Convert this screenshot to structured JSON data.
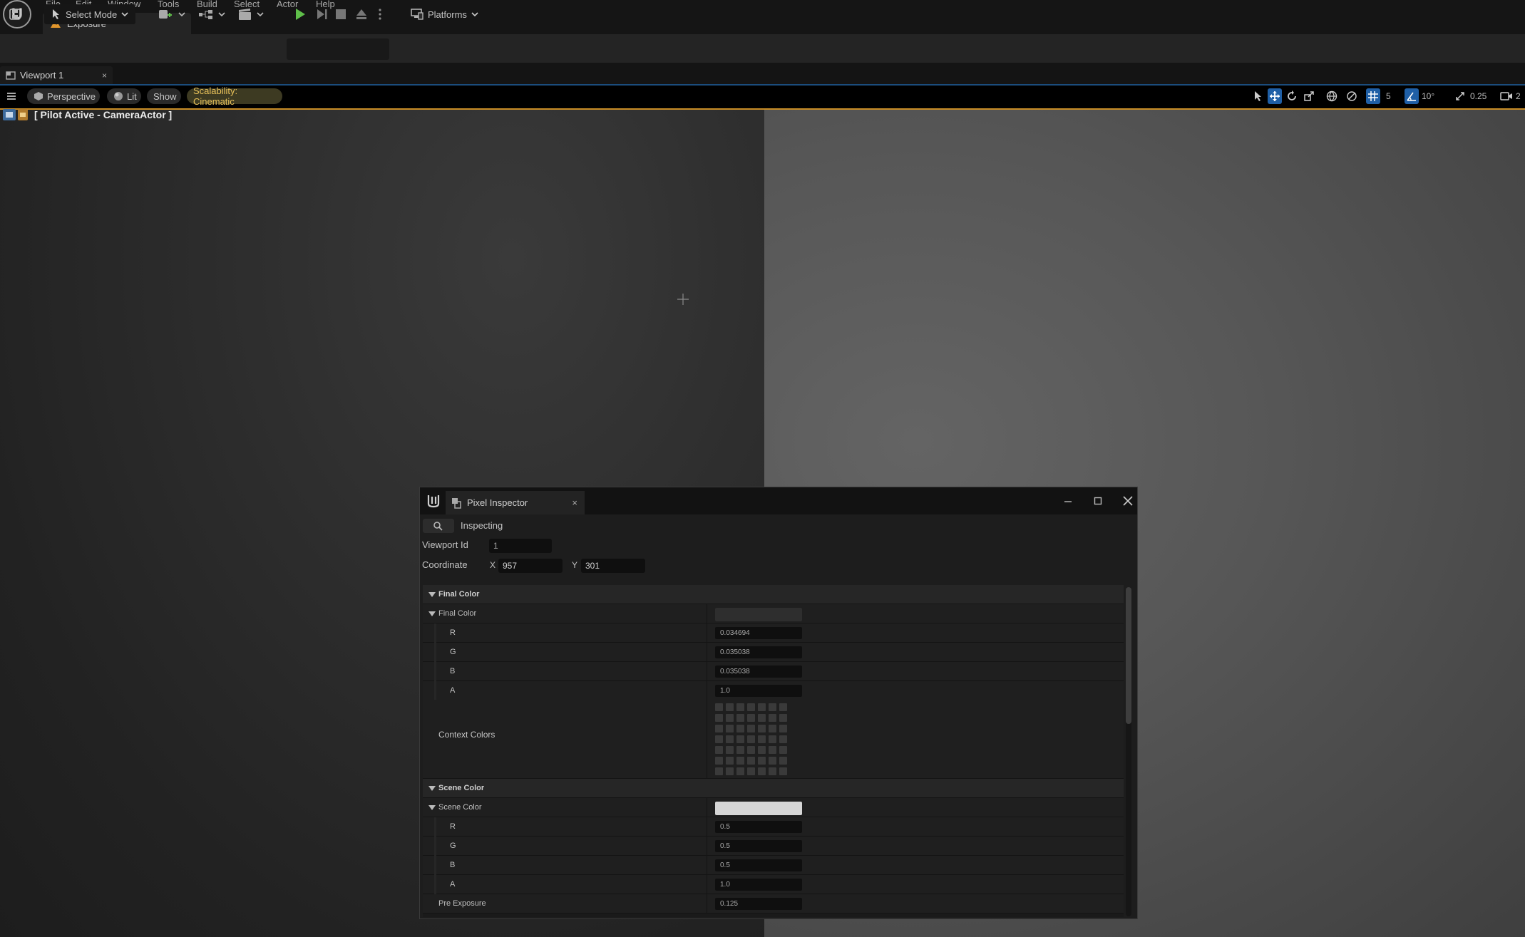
{
  "menu": {
    "items": [
      "File",
      "Edit",
      "Window",
      "Tools",
      "Build",
      "Select",
      "Actor",
      "Help"
    ]
  },
  "document_tab": {
    "label": "Exposure*"
  },
  "toolbar": {
    "select_mode": "Select Mode",
    "platforms": "Platforms"
  },
  "viewport_tab": {
    "label": "Viewport 1",
    "close": "×"
  },
  "viewport_bar": {
    "perspective": "Perspective",
    "lit": "Lit",
    "show": "Show",
    "scalability": "Scalability: Cinematic",
    "grid_size": "5",
    "rotation_snap": "10°",
    "scale_snap": "0.25",
    "camera_speed": "2"
  },
  "viewport": {
    "pilot_label": "[ Pilot Active - CameraActor ]"
  },
  "pixel_inspector": {
    "title": "Pixel Inspector",
    "close": "×",
    "inspecting_label": "Inspecting",
    "viewport_id_label": "Viewport Id",
    "viewport_id_value": "1",
    "coordinate_label": "Coordinate",
    "x_label": "X",
    "x_value": "957",
    "y_label": "Y",
    "y_value": "301",
    "final_color_section": "Final Color",
    "final_color_group": "Final Color",
    "final_color": {
      "R": "0.034694",
      "G": "0.035038",
      "B": "0.035038",
      "A": "1.0"
    },
    "final_color_swatch": "#2e2e2e",
    "context_colors_label": "Context Colors",
    "scene_color_section": "Scene Color",
    "scene_color_group": "Scene Color",
    "scene_color": {
      "R": "0.5",
      "G": "0.5",
      "B": "0.5",
      "A": "1.0"
    },
    "scene_color_swatch": "#d6d6d6",
    "pre_exposure_label": "Pre Exposure",
    "pre_exposure_value": "0.125",
    "channel_labels": {
      "R": "R",
      "G": "G",
      "B": "B",
      "A": "A"
    }
  }
}
